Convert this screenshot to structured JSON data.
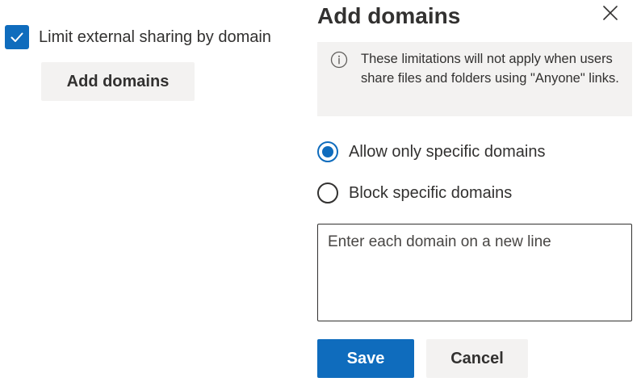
{
  "settings": {
    "limit_checkbox": {
      "label": "Limit external sharing by domain",
      "checked": true,
      "icon": "checkmark-icon"
    },
    "add_domains_button": "Add domains"
  },
  "panel": {
    "title": "Add domains",
    "close_icon": "close-icon",
    "info": {
      "icon": "info-icon",
      "text": "These limitations will not apply when users share files and folders using \"Anyone\" links."
    },
    "options": [
      {
        "label": "Allow only specific domains",
        "selected": true
      },
      {
        "label": "Block specific domains",
        "selected": false
      }
    ],
    "domains_input": {
      "value": "",
      "placeholder": "Enter each domain on a new line"
    },
    "save_label": "Save",
    "cancel_label": "Cancel"
  },
  "colors": {
    "accent": "#0f6cbd",
    "neutral_background": "#f3f2f1",
    "text": "#323130"
  }
}
